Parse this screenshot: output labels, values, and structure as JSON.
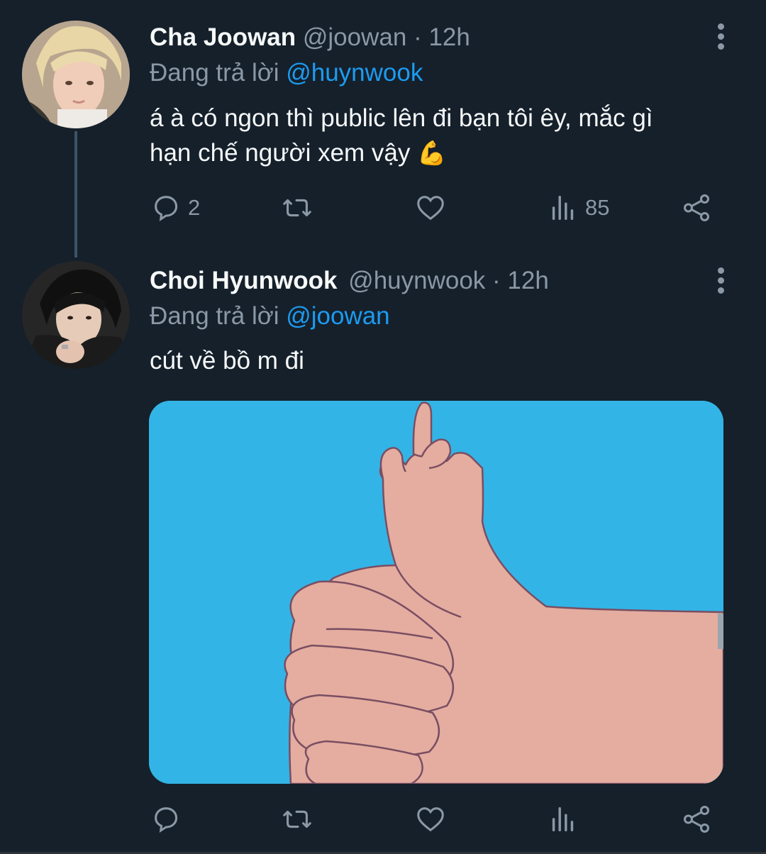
{
  "tweets": [
    {
      "name": "Cha Joowan",
      "handle": "@joowan",
      "time": "· 12h",
      "replying_prefix": "Đang trả lời",
      "replying_to": "@huynwook",
      "text_line1": "á à có ngon thì public lên đi bạn tôi êy, mắc gì",
      "text_line2": "hạn chế người xem vậy",
      "emoji": "💪",
      "actions": {
        "reply_count": "2",
        "retweet_count": "",
        "like_count": "",
        "views_count": "85"
      }
    },
    {
      "name": "Choi Hyunwook",
      "handle": "@huynwook",
      "time": "· 12h",
      "replying_prefix": "Đang trả lời",
      "replying_to": "@joowan",
      "text": "cút về bồ m đi",
      "actions": {
        "reply_count": "",
        "retweet_count": "",
        "like_count": "",
        "views_count": ""
      }
    }
  ],
  "colors": {
    "background": "#15202b",
    "secondary_text": "#8b98a5",
    "mention": "#1d9bf0",
    "media_sky": "#33b4e6",
    "media_skin": "#e4ada0"
  },
  "icons": [
    "more-vertical-icon",
    "reply-icon",
    "retweet-icon",
    "like-icon",
    "views-icon",
    "share-icon"
  ]
}
